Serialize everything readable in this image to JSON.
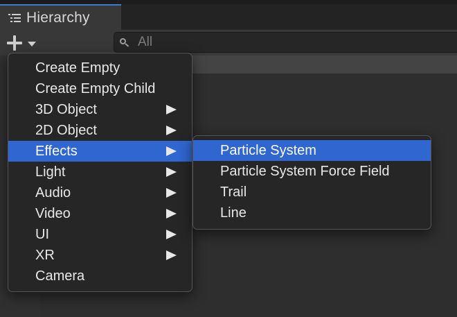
{
  "window": {
    "tab_title": "Hierarchy",
    "tab_icon": "hierarchy-list-icon"
  },
  "toolbar": {
    "add_icon": "plus-icon",
    "add_caret_icon": "caret-down-icon",
    "search": {
      "icon": "search-icon",
      "placeholder": "All",
      "value": ""
    }
  },
  "menu": {
    "items": [
      {
        "label": "Create Empty",
        "submenu": false
      },
      {
        "label": "Create Empty Child",
        "submenu": false
      },
      {
        "label": "3D Object",
        "submenu": true
      },
      {
        "label": "2D Object",
        "submenu": true
      },
      {
        "label": "Effects",
        "submenu": true,
        "active": true
      },
      {
        "label": "Light",
        "submenu": true
      },
      {
        "label": "Audio",
        "submenu": true
      },
      {
        "label": "Video",
        "submenu": true
      },
      {
        "label": "UI",
        "submenu": true
      },
      {
        "label": "XR",
        "submenu": true
      },
      {
        "label": "Camera",
        "submenu": false
      }
    ]
  },
  "submenu": {
    "items": [
      {
        "label": "Particle System",
        "active": true
      },
      {
        "label": "Particle System Force Field"
      },
      {
        "label": "Trail"
      },
      {
        "label": "Line"
      }
    ]
  },
  "colors": {
    "highlight": "#2f66cf",
    "tab_accent": "#3a79d6",
    "menu_bg": "#262626",
    "toolbar_bg": "#383838"
  }
}
